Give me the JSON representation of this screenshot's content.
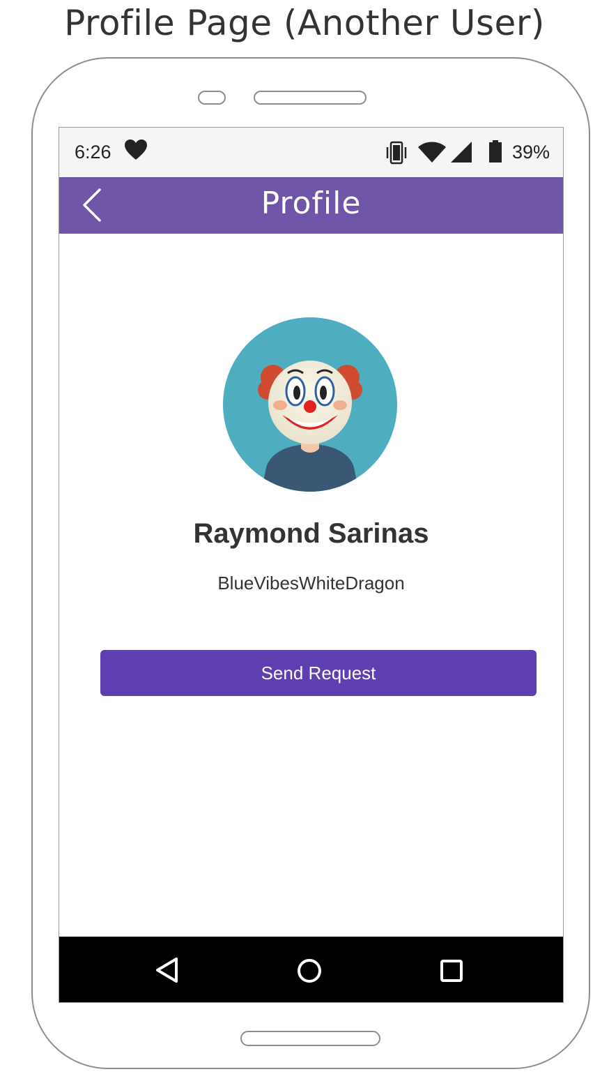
{
  "caption": "Profile Page (Another User)",
  "status_bar": {
    "time": "6:26",
    "battery_percent": "39%",
    "icons": [
      "heart-icon",
      "vibrate-icon",
      "wifi-icon",
      "cell-signal-icon",
      "battery-icon"
    ]
  },
  "app_bar": {
    "title": "Profile",
    "back_icon": "chevron-left-icon",
    "color": "#6e55a8"
  },
  "profile": {
    "avatar": "clown-avatar",
    "avatar_bg": "#4fadc0",
    "name": "Raymond Sarinas",
    "username": "BlueVibesWhiteDragon"
  },
  "actions": {
    "send_request_label": "Send Request",
    "button_color": "#5e3fb0"
  },
  "nav_bar": {
    "icons": [
      "nav-back-icon",
      "nav-home-icon",
      "nav-recents-icon"
    ]
  }
}
